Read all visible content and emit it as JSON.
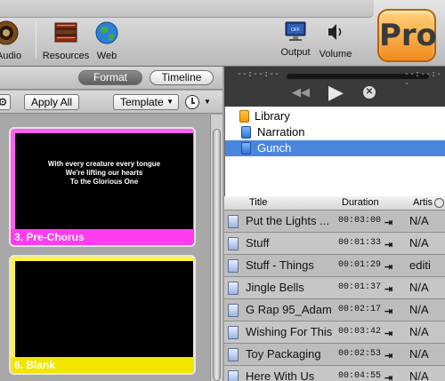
{
  "toolbar": {
    "audio_label": "Audio",
    "resources_label": "Resources",
    "web_label": "Web",
    "output_label": "Output",
    "output_badge": "OFF",
    "volume_label": "Volume",
    "logo_text": "Pro"
  },
  "left": {
    "tabs": {
      "format": "Format",
      "timeline": "Timeline"
    },
    "controls": {
      "apply_all": "Apply All",
      "template": "Template"
    },
    "slides": [
      {
        "lines": [
          "With every creature every tongue",
          "We're lifting our hearts",
          "To the Glorious One"
        ],
        "label": "3. Pre-Chorus",
        "color": "#ff3cf0"
      },
      {
        "lines": [],
        "label": "6. Blank",
        "color": "#f2e500"
      }
    ]
  },
  "player": {
    "time_left": "--:--:--",
    "time_right": "--:--:--"
  },
  "library": {
    "items": [
      {
        "label": "Library"
      },
      {
        "label": "Narration"
      },
      {
        "label": "Gunch"
      }
    ]
  },
  "list_toolbar": {
    "add_doc": "+",
    "add_folder": "+"
  },
  "songs": {
    "columns": {
      "title": "Title",
      "duration": "Duration",
      "artist": "Artis"
    },
    "rows": [
      {
        "title": "Put the Lights ...",
        "duration": "00:03:00",
        "artist": "N/A"
      },
      {
        "title": "Stuff",
        "duration": "00:01:33",
        "artist": "N/A"
      },
      {
        "title": "Stuff - Things",
        "duration": "00:01:29",
        "artist": "editi"
      },
      {
        "title": "Jingle Bells",
        "duration": "00:01:37",
        "artist": "N/A"
      },
      {
        "title": "G Rap 95_Adam",
        "duration": "00:02:17",
        "artist": "N/A"
      },
      {
        "title": "Wishing For This",
        "duration": "00:03:42",
        "artist": "N/A"
      },
      {
        "title": "Toy Packaging",
        "duration": "00:02:53",
        "artist": "N/A"
      },
      {
        "title": "Here With Us",
        "duration": "00:04:55",
        "artist": "N/A"
      }
    ]
  },
  "colors": {
    "selection": "#4a86de",
    "slide1": "#ff3cf0",
    "slide2": "#f2e500"
  }
}
